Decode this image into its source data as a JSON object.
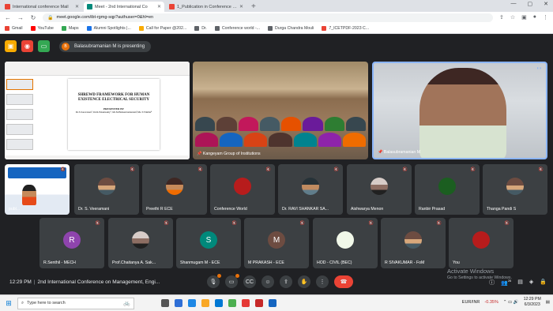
{
  "browser": {
    "tabs": [
      {
        "label": "International conference Mail",
        "color": "#ea4335",
        "active": false
      },
      {
        "label": "Meet - 2nd International Co",
        "color": "#00897b",
        "active": true
      },
      {
        "label": "1_Publication in Conference pro",
        "color": "#ea4335",
        "active": false
      }
    ],
    "url": "meet.google.com/ibt-rgmg-sqp?authuser=0&hl=en",
    "bookmarks": [
      {
        "label": "Gmail",
        "color": "#ea4335"
      },
      {
        "label": "YouTube",
        "color": "#ff0000"
      },
      {
        "label": "Maps",
        "color": "#34a853"
      },
      {
        "label": "Alumni Spotlights |...",
        "color": "#1a73e8"
      },
      {
        "label": "Call for Paper @202...",
        "color": "#f9ab00"
      },
      {
        "label": "Dr.",
        "color": "#5f6368"
      },
      {
        "label": "Conference world -...",
        "color": "#5f6368"
      },
      {
        "label": "Durga Chandra Mouli",
        "color": "#5f6368"
      },
      {
        "label": "7_ICETPDF-2023 C...",
        "color": "#ea4335"
      }
    ]
  },
  "meet": {
    "presenting_initial": "B",
    "presenting_text": "Balasubramanian M is presenting",
    "slide": {
      "title": "SHREWD FRAMEWORK FOR HUMAN EXISTENCE ELECTRICAL SECURITY",
      "presented_by": "PRESENTED BY",
      "authors": "Dr.S.Saravanan¹, Dr.R.Palanisamy², Mr.M.Balasubramanian³,Ms.T.Vinitha⁴"
    },
    "main_tiles": [
      {
        "name": "Kangeyam Group of Institutions"
      },
      {
        "name": "Balasubramanian M"
      }
    ],
    "row1": [
      {
        "name": "publ..."
      },
      {
        "name": "Dr. S. Veeramani"
      },
      {
        "name": "Preethi R ECE"
      },
      {
        "name": "Conference World"
      },
      {
        "name": "Dr. RAVI SHANKAR SA..."
      },
      {
        "name": "Aishwarya Menon"
      },
      {
        "name": "Ranbir Prasad"
      },
      {
        "name": "Thanga Pandi S"
      }
    ],
    "row2": [
      {
        "name": "R.Senthil - MECH",
        "initial": "R"
      },
      {
        "name": "Prof.Chaitanya A. Sak..."
      },
      {
        "name": "Shanmugam M - ECE",
        "initial": "S"
      },
      {
        "name": "M PRAKASH - ECE",
        "initial": "M"
      },
      {
        "name": "HOD - CIVIL (BEC)"
      },
      {
        "name": "R SIVAKUMAR - FoM"
      },
      {
        "name": "You"
      }
    ],
    "time": "12:29 PM",
    "meeting_title": "2nd International Conference on Management, Engi...",
    "activate_title": "Activate Windows",
    "activate_sub": "Go to Settings to activate Windows.",
    "people_count": "26"
  },
  "taskbar": {
    "search_placeholder": "Type here to search",
    "currency": "EUR/INR",
    "currency_change": "-0.35%",
    "time": "12:29 PM",
    "date": "6/3/2023"
  }
}
